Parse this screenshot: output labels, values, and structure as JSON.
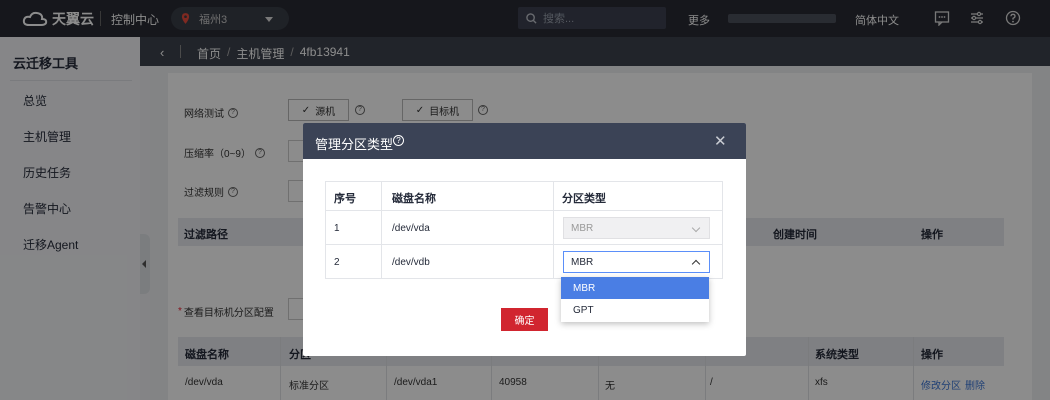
{
  "topbar": {
    "brand": "天翼云",
    "console": "控制中心",
    "region": "福州3",
    "search_placeholder": "搜索...",
    "more": "更多",
    "language": "简体中文",
    "icons": [
      "message-icon",
      "settings-icon",
      "help-icon"
    ]
  },
  "sidebar": {
    "title": "云迁移工具",
    "items": [
      {
        "label": "总览"
      },
      {
        "label": "主机管理"
      },
      {
        "label": "历史任务"
      },
      {
        "label": "告警中心"
      },
      {
        "label": "迁移Agent"
      }
    ]
  },
  "breadcrumb": [
    "首页",
    "主机管理",
    "4fb13941"
  ],
  "form": {
    "network_test_label": "网络测试",
    "source_btn": "源机",
    "target_btn": "目标机",
    "compress_label": "压缩率（0~9）",
    "filter_label": "过滤规则",
    "filter_table": {
      "col_path": "过滤路径",
      "col_created": "创建时间",
      "col_action": "操作"
    },
    "partition_config_label": "查看目标机分区配置",
    "required_mark": "*"
  },
  "disk_table": {
    "headers": [
      "磁盘名称",
      "分区",
      "系统类型",
      "操作"
    ],
    "row": {
      "disk": "/dev/vda",
      "part_type": "标准分区",
      "part_name": "/dev/vda1",
      "size": "40958",
      "flag": "无",
      "mount": "/",
      "fs": "xfs",
      "edit": "修改分区",
      "delete": "删除"
    }
  },
  "dialog": {
    "title": "管理分区类型",
    "headers": {
      "seq": "序号",
      "disk": "磁盘名称",
      "type": "分区类型"
    },
    "rows": [
      {
        "seq": "1",
        "disk": "/dev/vda",
        "type": "MBR"
      },
      {
        "seq": "2",
        "disk": "/dev/vdb",
        "type": "MBR"
      }
    ],
    "dropdown_options": [
      "MBR",
      "GPT"
    ],
    "confirm": "确定"
  },
  "colors": {
    "topbar": "#282b33",
    "accent_blue": "#4a7ee4",
    "confirm_red": "#d1252f",
    "dialog_header": "#3b4356"
  }
}
